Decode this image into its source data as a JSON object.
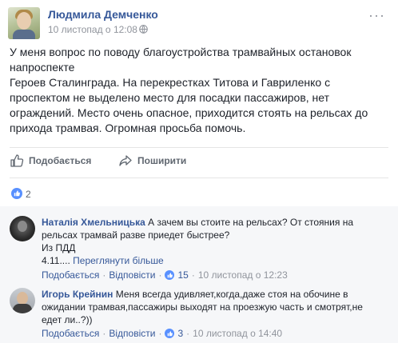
{
  "post": {
    "author": "Людмила Демченко",
    "time": "10 листопад о 12:08",
    "more": "···",
    "text_lines": [
      "У меня вопрос по поводу благоустройства трамвайных остановок",
      "напроспекте",
      "Героев Сталинграда. На перекрестках Титова и Гавриленко с",
      "проспектом не выделено место для посадки пассажиров, нет",
      "ограждений. Место очень опасное, приходится стоять на рельсах до",
      "прихода трамвая. Огромная просьба помочь."
    ]
  },
  "actions": {
    "like": "Подобається",
    "share": "Поширити"
  },
  "reactions": {
    "count": "2"
  },
  "comments": [
    {
      "author": "Наталія Хмельницька",
      "text_first": "А зачем вы стоите на рельсах? От стояния на",
      "text_lines": [
        "рельсах трамвай разве приедет быстрее?",
        "Из ПДД"
      ],
      "extra_prefix": "4.11....",
      "extra_link": "Переглянути більше",
      "like": "Подобається",
      "reply": "Відповісти",
      "likes": "15",
      "time": "10 листопад о 12:23",
      "sep": "·"
    },
    {
      "author": "Игорь Крейнин",
      "text_first": "Меня всегда удивляет,когда,даже стоя на обочине в",
      "text_lines": [
        "ожидании трамвая,пассажиры выходят на проезжую часть и смотрят,не",
        "едет ли..?))"
      ],
      "like": "Подобається",
      "reply": "Відповісти",
      "likes": "3",
      "time": "10 листопад о 14:40",
      "sep": "·"
    }
  ],
  "colors": {
    "link": "#365899",
    "meta": "#90949c",
    "like_blue": "#5890ff",
    "comments_bg": "#f6f7f9"
  }
}
